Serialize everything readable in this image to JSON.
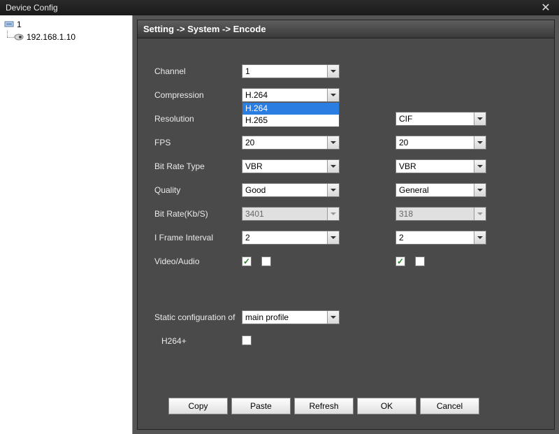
{
  "window": {
    "title": "Device Config"
  },
  "tree": {
    "root": "1",
    "child": "192.168.1.10"
  },
  "breadcrumb": "Setting -> System -> Encode",
  "labels": {
    "channel": "Channel",
    "compression": "Compression",
    "resolution": "Resolution",
    "fps": "FPS",
    "bitratetype": "Bit Rate Type",
    "quality": "Quality",
    "bitrate": "Bit Rate(Kb/S)",
    "iframe": "I Frame Interval",
    "videoaudio": "Video/Audio",
    "staticconf": "Static configuration of",
    "h264plus": "H264+"
  },
  "main": {
    "channel": "1",
    "compression": "H.264",
    "compression_options": {
      "opt1": "H.264",
      "opt2": "H.265"
    },
    "fps": "20",
    "bitratetype": "VBR",
    "quality": "Good",
    "bitrate": "3401",
    "iframe": "2"
  },
  "sub": {
    "resolution": "CIF",
    "fps": "20",
    "bitratetype": "VBR",
    "quality": "General",
    "bitrate": "318",
    "iframe": "2"
  },
  "static_profile": "main profile",
  "buttons": {
    "copy": "Copy",
    "paste": "Paste",
    "refresh": "Refresh",
    "ok": "OK",
    "cancel": "Cancel"
  }
}
